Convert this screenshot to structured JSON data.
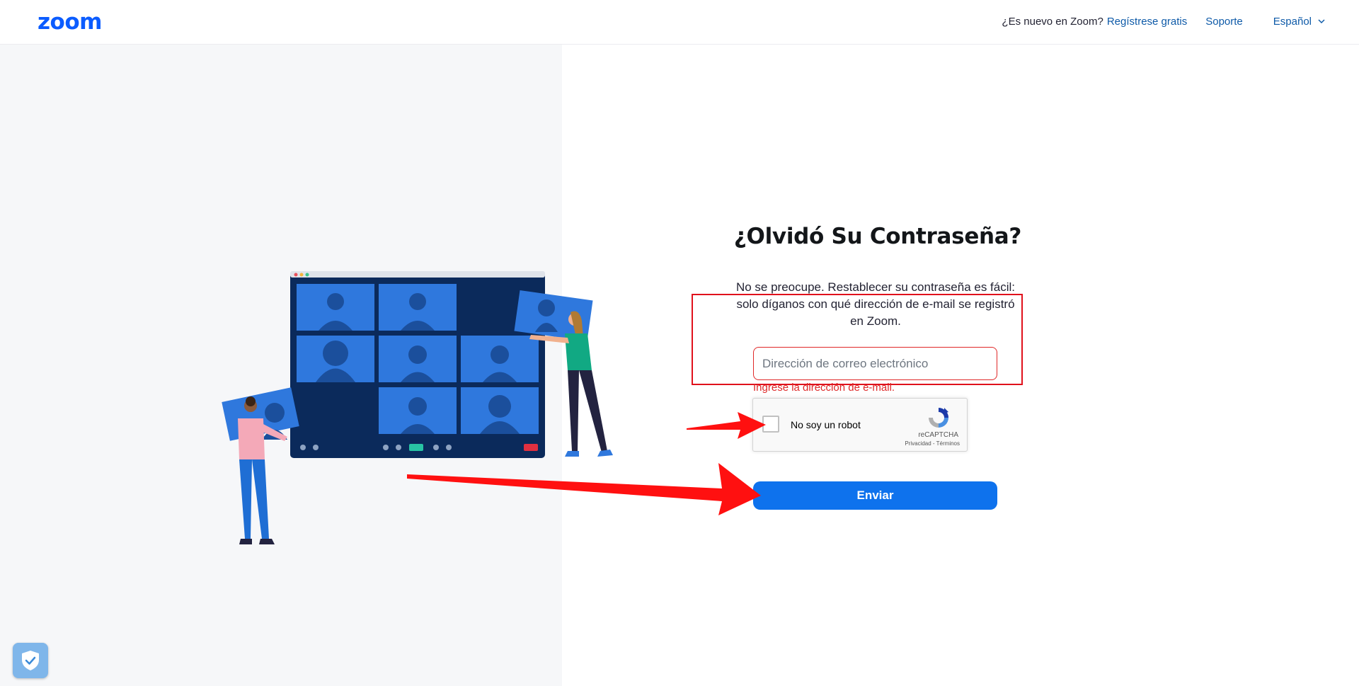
{
  "header": {
    "logo_text": "zoom",
    "new_question": "¿Es nuevo en Zoom?",
    "signup_label": "Regístrese gratis",
    "support_label": "Soporte",
    "language_label": "Español"
  },
  "form": {
    "title": "¿Olvidó Su Contraseña?",
    "description": "No se preocupe. Restablecer su contraseña es fácil: solo díganos con qué dirección de e-mail se registró en Zoom.",
    "email_placeholder": "Dirección de correo electrónico",
    "email_value": "",
    "error_text": "Ingrese la dirección de e-mail.",
    "submit_label": "Enviar"
  },
  "recaptcha": {
    "label": "No soy un robot",
    "brand": "reCAPTCHA",
    "links": "Privacidad - Términos"
  },
  "colors": {
    "brand_blue": "#0b5cff",
    "button_blue": "#0e72ed",
    "error_red": "#de2828",
    "annotation_red": "#ff0000"
  },
  "icons": {
    "language_chevron": "chevron-down-icon",
    "captcha_logo": "recaptcha-logo-icon",
    "privacy_badge": "shield-check-icon"
  }
}
